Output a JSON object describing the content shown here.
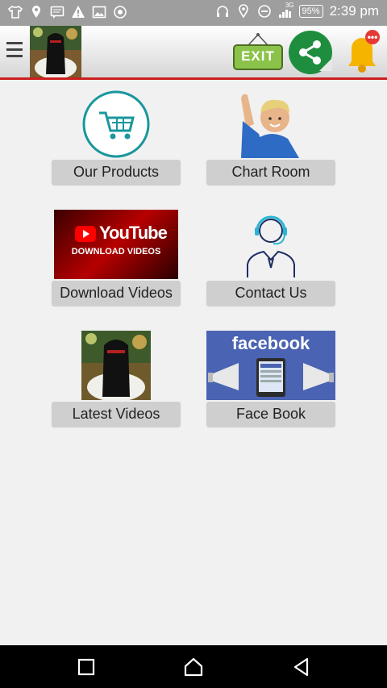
{
  "status_bar": {
    "battery": "95%",
    "signal_label": "3G",
    "time": "2:39 pm",
    "left_icons": [
      "shirt-icon",
      "location-icon",
      "message-icon",
      "warning-icon",
      "image-icon",
      "camera-icon"
    ],
    "right_icons": [
      "headset-icon",
      "location-icon",
      "minus-circle-icon",
      "signal-icon",
      "battery-icon"
    ]
  },
  "app_bar": {
    "exit_label": "EXIT",
    "notification_badge": "•••",
    "colors": {
      "divider": "#cc1f1f",
      "share": "#1e8e3e",
      "bell": "#f5b400",
      "badge": "#e53935"
    }
  },
  "tiles": [
    {
      "label": "Our Products",
      "icon": "shopping-cart-icon"
    },
    {
      "label": "Chart Room",
      "icon": "waving-man-icon"
    },
    {
      "label": "Download Videos",
      "icon": "youtube-download-banner",
      "banner_title": "YouTube",
      "banner_sub": "DOWNLOAD VIDEOS"
    },
    {
      "label": "Contact Us",
      "icon": "support-agent-icon"
    },
    {
      "label": "Latest Videos",
      "icon": "person-photo"
    },
    {
      "label": "Face Book",
      "icon": "facebook-banner",
      "banner_title": "facebook"
    }
  ],
  "nav_bar": {
    "items": [
      "recent-apps",
      "home",
      "back"
    ]
  }
}
